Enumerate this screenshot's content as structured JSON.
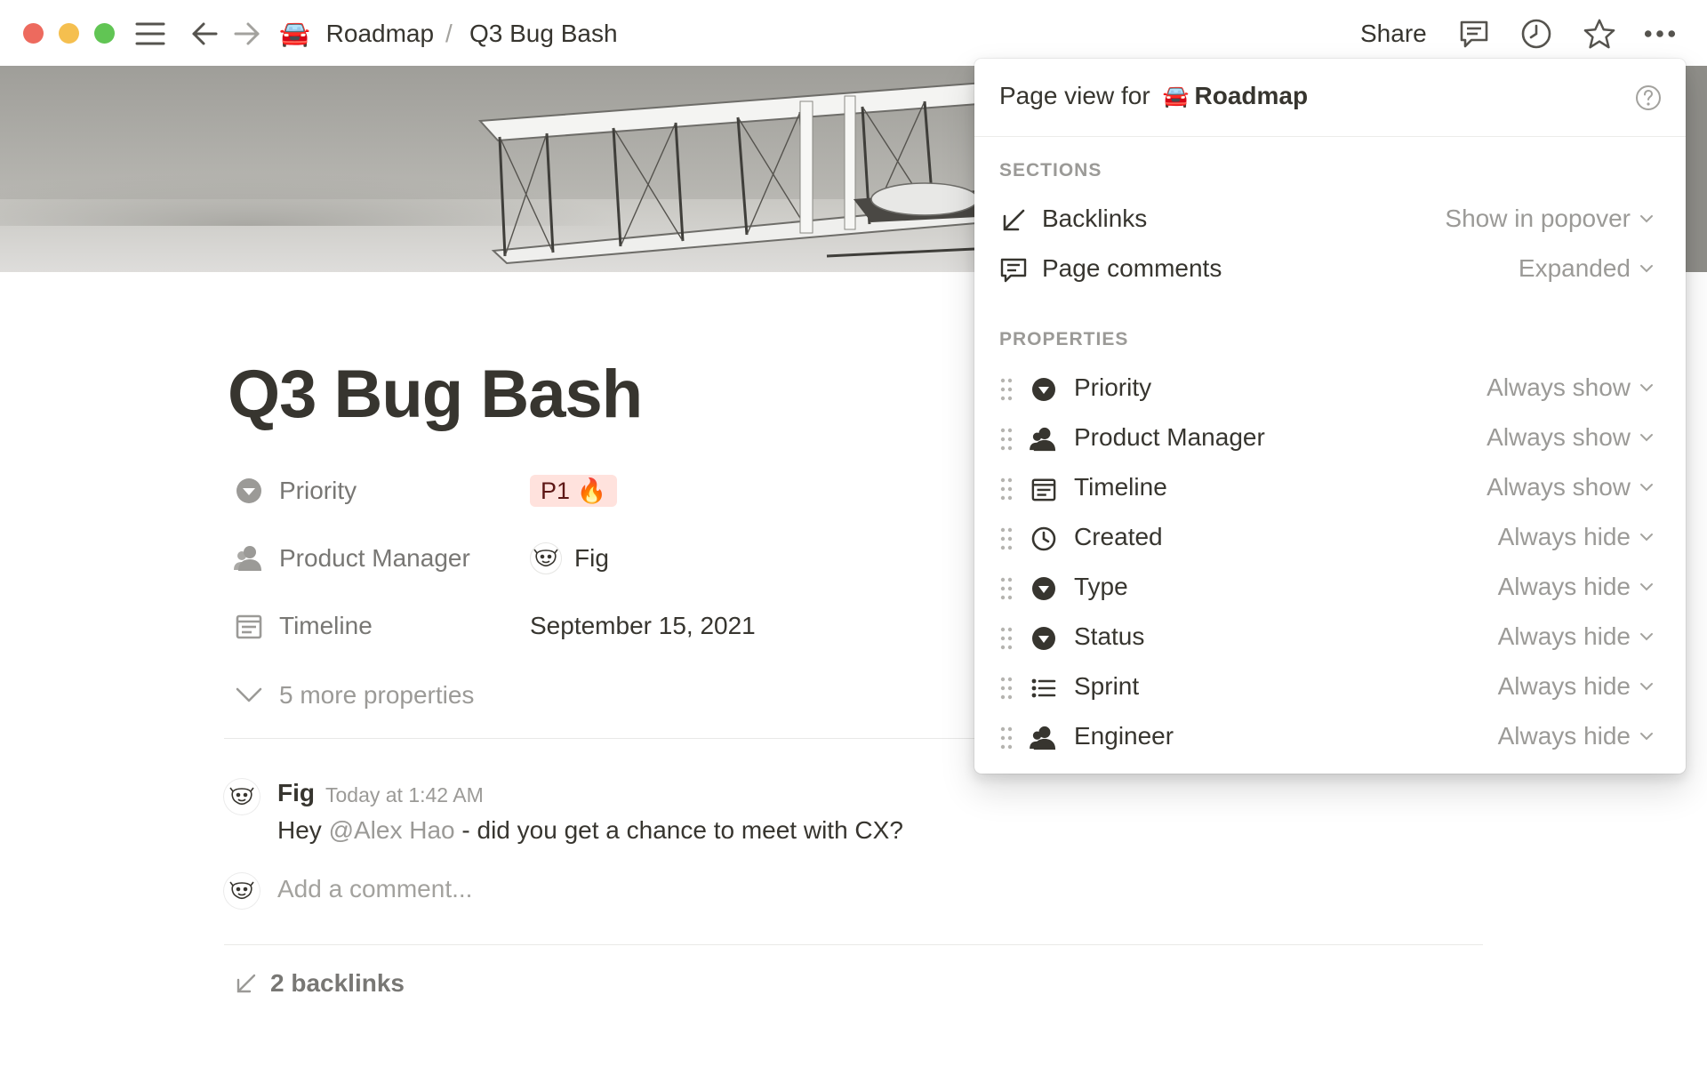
{
  "window": {
    "breadcrumb": [
      {
        "icon": "car-emoji",
        "label": "Roadmap"
      },
      {
        "label": "Q3 Bug Bash"
      }
    ],
    "breadcrumb_separator": "/",
    "car_emoji": "🚘",
    "share_label": "Share",
    "icons": [
      "sidebar-menu-icon",
      "back-arrow-icon",
      "forward-arrow-icon",
      "comments-icon",
      "history-clock-icon",
      "star-icon",
      "more-icon"
    ]
  },
  "page": {
    "title": "Q3 Bug Bash",
    "properties": [
      {
        "icon": "select-icon",
        "label": "Priority",
        "value": "P1 🔥",
        "tag_color": "#ffe2dd"
      },
      {
        "icon": "person-icon",
        "label": "Product Manager",
        "value": "Fig"
      },
      {
        "icon": "calendar-icon",
        "label": "Timeline",
        "value": "September 15, 2021"
      }
    ],
    "more_properties": "5 more properties",
    "comment": {
      "author": "Fig",
      "time": "Today at 1:42 AM",
      "text_before": "Hey ",
      "mention": "@Alex Hao",
      "text_after": " - did you get a chance to meet with CX?"
    },
    "add_comment_placeholder": "Add a comment...",
    "backlinks": "2 backlinks"
  },
  "popover": {
    "title_prefix": "Page view for",
    "title_emoji": "🚘",
    "title_page": "Roadmap",
    "sections_label": "SECTIONS",
    "sections": [
      {
        "icon": "backlink-arrow-icon",
        "label": "Backlinks",
        "value": "Show in popover"
      },
      {
        "icon": "comment-icon",
        "label": "Page comments",
        "value": "Expanded"
      }
    ],
    "properties_label": "PROPERTIES",
    "properties": [
      {
        "icon": "select-icon",
        "label": "Priority",
        "value": "Always show"
      },
      {
        "icon": "person-icon",
        "label": "Product Manager",
        "value": "Always show"
      },
      {
        "icon": "calendar-icon",
        "label": "Timeline",
        "value": "Always show"
      },
      {
        "icon": "clock-icon",
        "label": "Created",
        "value": "Always hide"
      },
      {
        "icon": "select-icon",
        "label": "Type",
        "value": "Always hide"
      },
      {
        "icon": "select-icon",
        "label": "Status",
        "value": "Always hide"
      },
      {
        "icon": "list-icon",
        "label": "Sprint",
        "value": "Always hide"
      },
      {
        "icon": "person-icon",
        "label": "Engineer",
        "value": "Always hide"
      }
    ]
  },
  "colors": {
    "text": "#37352f",
    "muted": "#9b9a97",
    "tag_red_bg": "#ffe2dd",
    "close": "#ed6a5e",
    "minimize": "#f5bf4f",
    "zoom": "#61c554"
  }
}
